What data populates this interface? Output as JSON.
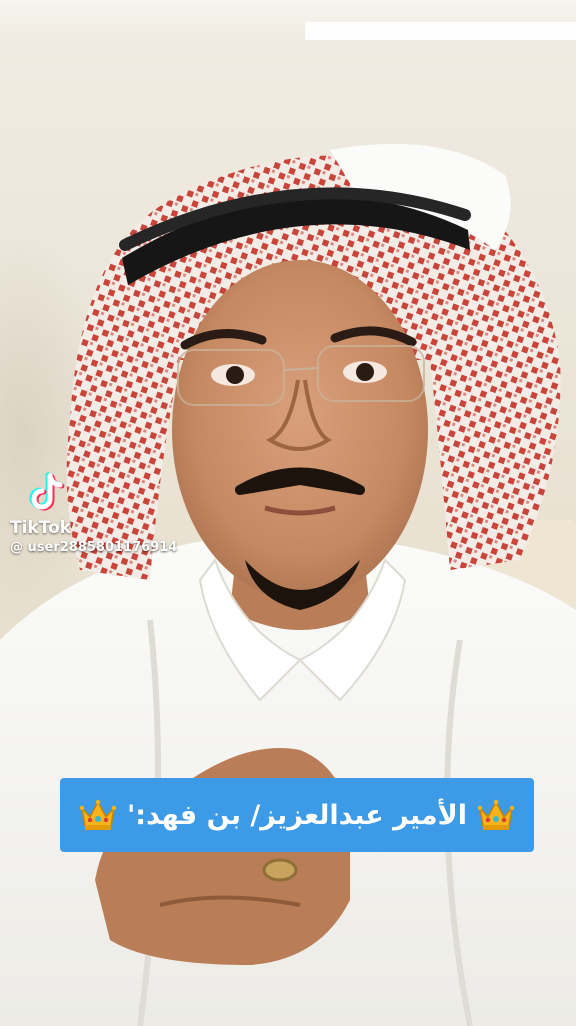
{
  "watermark": {
    "brand": "TikTok",
    "username": "@ user2885801176914",
    "icon": "tiktok-note-icon"
  },
  "caption": {
    "text": "الأمير عبدالعزيز/ بن فهد:'",
    "left_icon": "crown-icon",
    "right_icon": "crown-icon",
    "background_color": "#3d9ae6"
  }
}
